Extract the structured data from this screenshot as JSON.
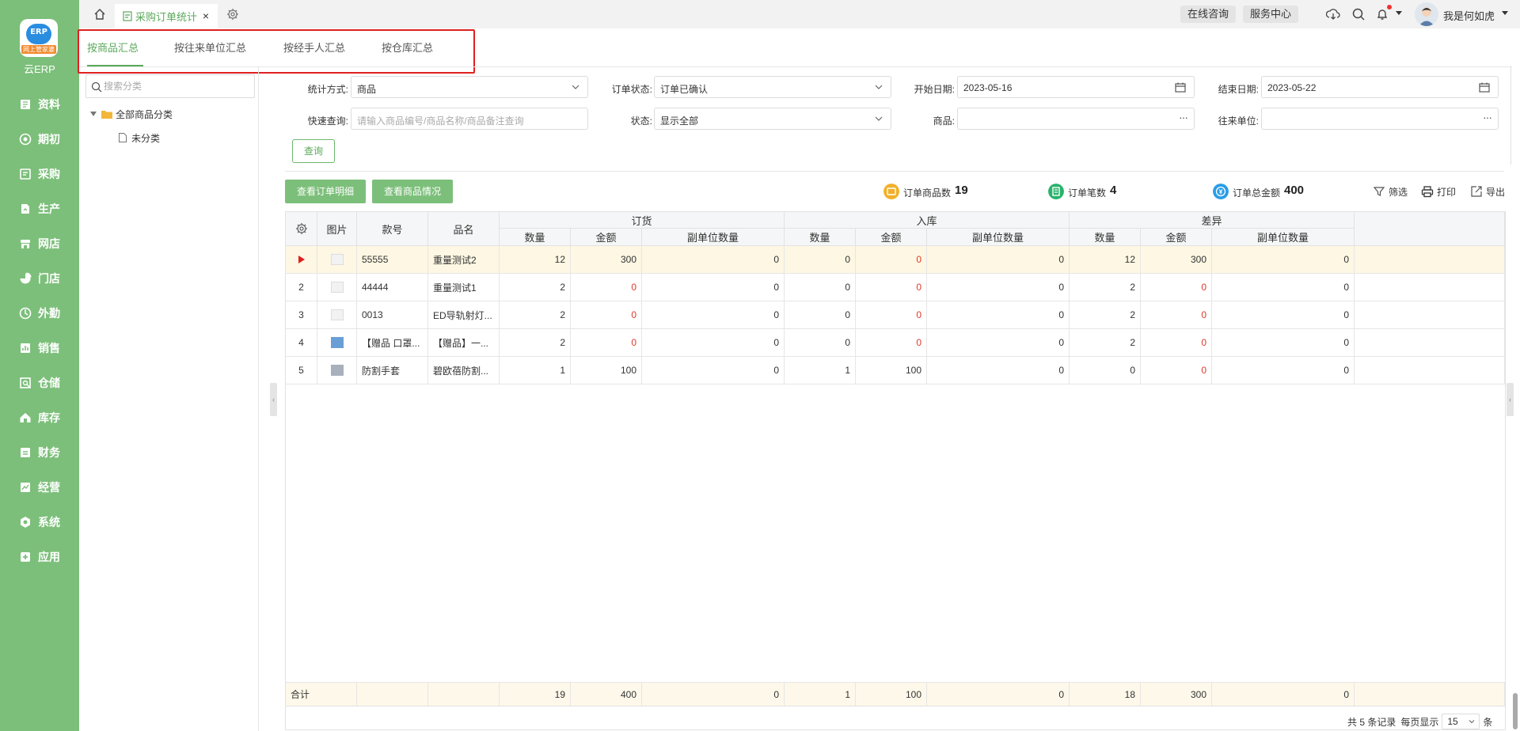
{
  "app": {
    "logo_text": "ERP",
    "logo_banner": "网上管家婆",
    "title": "云ERP"
  },
  "nav": [
    {
      "label": "资料",
      "icon": "book-icon"
    },
    {
      "label": "期初",
      "icon": "target-icon"
    },
    {
      "label": "采购",
      "icon": "cart-icon"
    },
    {
      "label": "生产",
      "icon": "production-icon"
    },
    {
      "label": "网店",
      "icon": "shop-icon"
    },
    {
      "label": "门店",
      "icon": "pie-icon"
    },
    {
      "label": "外勤",
      "icon": "fieldwork-icon"
    },
    {
      "label": "销售",
      "icon": "chart-icon"
    },
    {
      "label": "仓储",
      "icon": "warehouse-icon"
    },
    {
      "label": "库存",
      "icon": "home-stock-icon"
    },
    {
      "label": "财务",
      "icon": "finance-icon"
    },
    {
      "label": "经营",
      "icon": "operation-icon"
    },
    {
      "label": "系统",
      "icon": "system-icon"
    },
    {
      "label": "应用",
      "icon": "plus-icon"
    }
  ],
  "topbar": {
    "tab_label": "采购订单统计",
    "close_glyph": "×",
    "online_consult": "在线咨询",
    "service_center": "服务中心",
    "user_name": "我是何如虎"
  },
  "summary_tabs": [
    "按商品汇总",
    "按往来单位汇总",
    "按经手人汇总",
    "按仓库汇总"
  ],
  "left_panel": {
    "search_placeholder": "搜索分类",
    "tree_root": "全部商品分类",
    "tree_child": "未分类"
  },
  "filters": {
    "stat_method_label": "统计方式:",
    "stat_method_value": "商品",
    "order_status_label": "订单状态:",
    "order_status_value": "订单已确认",
    "start_date_label": "开始日期:",
    "start_date_value": "2023-05-16",
    "end_date_label": "结束日期:",
    "end_date_value": "2023-05-22",
    "quick_query_label": "快速查询:",
    "quick_query_placeholder": "请输入商品编号/商品名称/商品备注查询",
    "status_label": "状态:",
    "status_value": "显示全部",
    "product_label": "商品:",
    "partner_label": "往来单位:",
    "query_button": "查询"
  },
  "actions": {
    "view_order_detail": "查看订单明细",
    "view_product": "查看商品情况"
  },
  "stats": {
    "order_items_label": "订单商品数",
    "order_items_value": "19",
    "order_count_label": "订单笔数",
    "order_count_value": "4",
    "order_total_label": "订单总金额",
    "order_total_value": "400",
    "colors": {
      "items": "#f2b02a",
      "count": "#28b36b",
      "total": "#2a9de8"
    }
  },
  "tools": {
    "filter": "筛选",
    "print": "打印",
    "export": "导出"
  },
  "table": {
    "headers": {
      "picture": "图片",
      "code": "款号",
      "name": "品名",
      "group_order": "订货",
      "group_in": "入库",
      "group_diff": "差异",
      "qty": "数量",
      "amount": "金额",
      "sub_qty": "副单位数量"
    },
    "rows": [
      {
        "idx": "",
        "pic": "placeholder",
        "code": "55555",
        "name": "重量测试2",
        "values": [
          "12",
          "300",
          "0",
          "0",
          "0",
          "0",
          "12",
          "300",
          "0"
        ],
        "selected": true
      },
      {
        "idx": "2",
        "pic": "placeholder",
        "code": "44444",
        "name": "重量测试1",
        "values": [
          "2",
          "0",
          "0",
          "0",
          "0",
          "0",
          "2",
          "0",
          "0"
        ]
      },
      {
        "idx": "3",
        "pic": "placeholder",
        "code": "0013",
        "name": "ED导轨射灯...",
        "values": [
          "2",
          "0",
          "0",
          "0",
          "0",
          "0",
          "2",
          "0",
          "0"
        ]
      },
      {
        "idx": "4",
        "pic": "blue",
        "code": "【赠品 口罩...",
        "name": "【赠品】一...",
        "values": [
          "2",
          "0",
          "0",
          "0",
          "0",
          "0",
          "2",
          "0",
          "0"
        ]
      },
      {
        "idx": "5",
        "pic": "gray",
        "code": "防割手套",
        "name": "碧欧蓓防割...",
        "values": [
          "1",
          "100",
          "0",
          "1",
          "100",
          "0",
          "0",
          "0",
          "0"
        ]
      }
    ],
    "footer_label": "合计",
    "footer_values": [
      "19",
      "400",
      "0",
      "1",
      "100",
      "0",
      "18",
      "300",
      "0"
    ]
  },
  "pager": {
    "total_text": "共 5 条记录",
    "per_page_label": "每页显示",
    "per_page_value": "15",
    "unit": "条"
  }
}
